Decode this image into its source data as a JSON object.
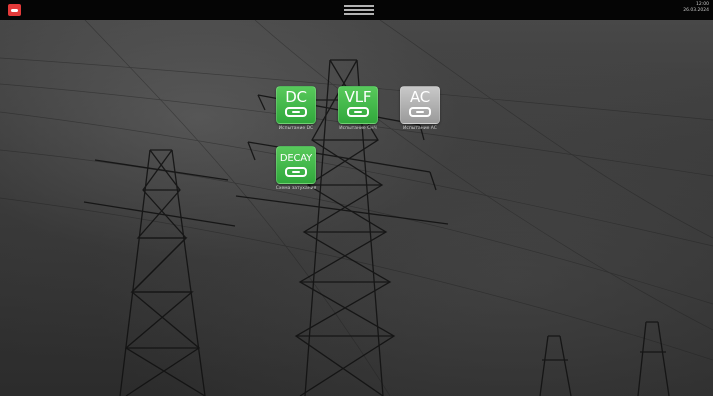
{
  "status": {
    "time": "12:00",
    "date": "26.03.2024"
  },
  "apps": [
    {
      "tile_text": "DC",
      "label": "Испытание DC",
      "color": "green"
    },
    {
      "tile_text": "VLF",
      "label": "Испытание СНЧ",
      "color": "green"
    },
    {
      "tile_text": "AC",
      "label": "Испытание AC",
      "color": "grey"
    },
    {
      "tile_text": "DECAY",
      "label": "Схема затухания",
      "color": "green"
    }
  ],
  "colors": {
    "statusbar": "#050505",
    "logo": "#e43a3a",
    "tile_green": "#31a83c",
    "tile_grey": "#9a9a9a"
  }
}
